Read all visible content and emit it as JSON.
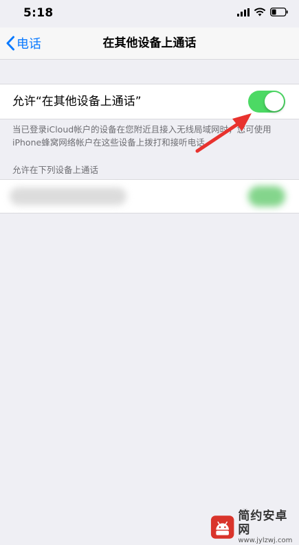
{
  "status_bar": {
    "time": "5:18",
    "icons": [
      "signal-icon",
      "wifi-icon",
      "battery-icon"
    ]
  },
  "nav": {
    "back_label": "电话",
    "title": "在其他设备上通话"
  },
  "settings": {
    "allow_label": "允许“在其他设备上通话”",
    "allow_toggle_on": true,
    "footer_text": "当已登录iCloud帐户的设备在您附近且接入无线局域网时，您可使用iPhone蜂窝网络帐户在这些设备上拨打和接听电话。",
    "section_header": "允许在下列设备上通话"
  },
  "colors": {
    "accent": "#0a7aff",
    "toggle_on": "#4cd964",
    "arrow": "#e8322e",
    "background": "#efeff4"
  },
  "watermark": {
    "name": "简约安卓网",
    "url": "www.jylzwj.com",
    "faint": "∞"
  }
}
